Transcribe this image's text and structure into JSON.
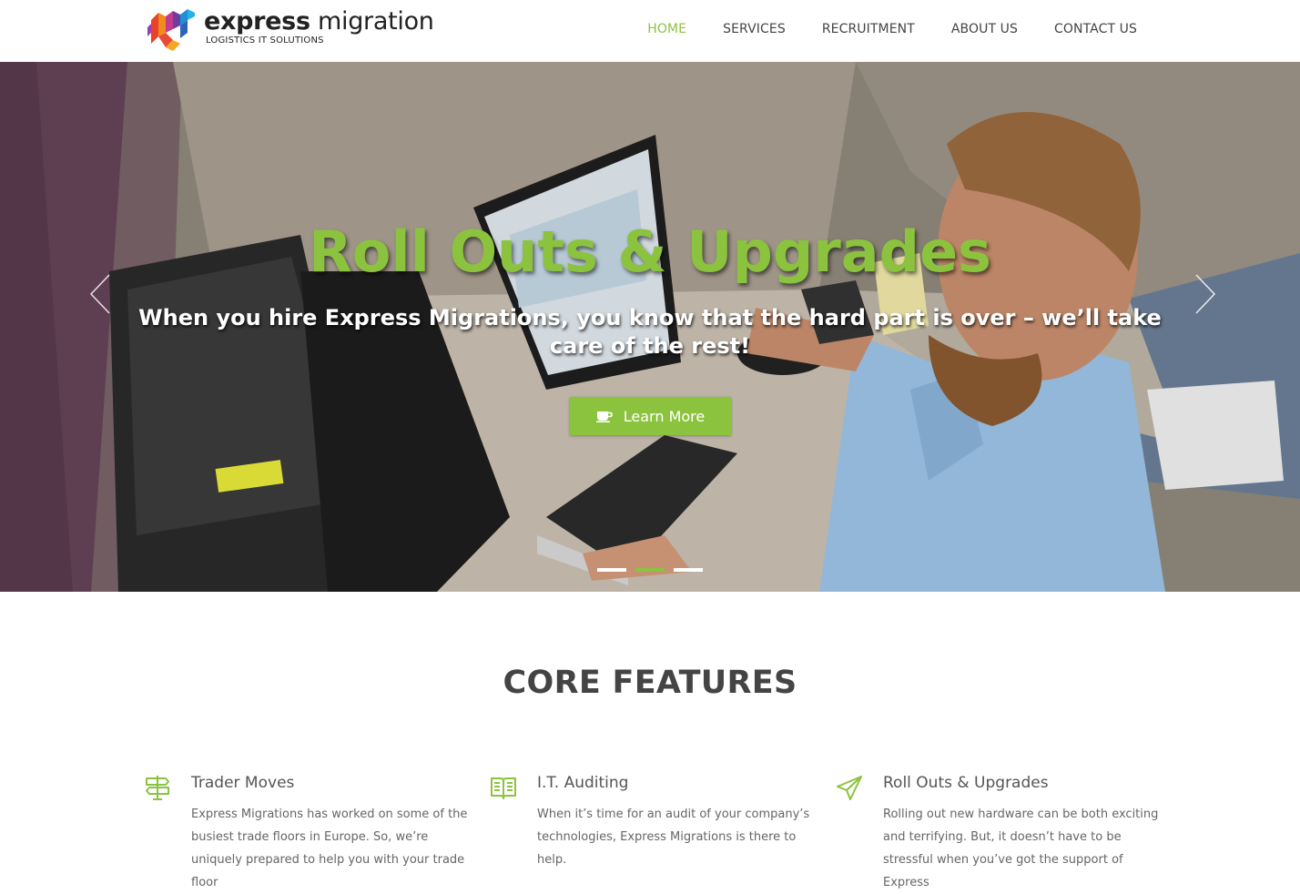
{
  "brand": {
    "name_bold": "express",
    "name_light": " migration",
    "tagline": "LOGISTICS IT SOLUTIONS"
  },
  "nav": {
    "items": [
      {
        "label": "HOME",
        "active": true
      },
      {
        "label": "SERVICES",
        "active": false
      },
      {
        "label": "RECRUITMENT",
        "active": false
      },
      {
        "label": "ABOUT US",
        "active": false
      },
      {
        "label": "CONTACT US",
        "active": false
      }
    ]
  },
  "hero": {
    "title": "Roll Outs & Upgrades",
    "subtitle": "When you hire Express Migrations, you know that the hard part is over – we’ll take care of the rest!",
    "button_label": "Learn More",
    "button_icon": "coffee-cup-icon",
    "prev_icon": "chevron-left-icon",
    "next_icon": "chevron-right-icon",
    "slides_total": 3,
    "slide_active": 2
  },
  "features": {
    "title": "CORE FEATURES",
    "items": [
      {
        "icon": "signpost-icon",
        "title": "Trader Moves",
        "text": "Express Migrations has worked on some of the busiest trade floors in Europe. So, we’re uniquely prepared to help you with your trade floor"
      },
      {
        "icon": "open-book-icon",
        "title": "I.T. Auditing",
        "text": "When it’s time for an audit of your company’s technologies, Express Migrations is there to help."
      },
      {
        "icon": "paper-plane-icon",
        "title": "Roll Outs & Upgrades",
        "text": "Rolling out new hardware can be both exciting and terrifying. But, it doesn’t have to be stressful when you’ve got the support of Express"
      }
    ]
  },
  "colors": {
    "accent": "#8bc33e",
    "text_dark": "#444444",
    "text_body": "#666666",
    "background": "#ffffff"
  }
}
